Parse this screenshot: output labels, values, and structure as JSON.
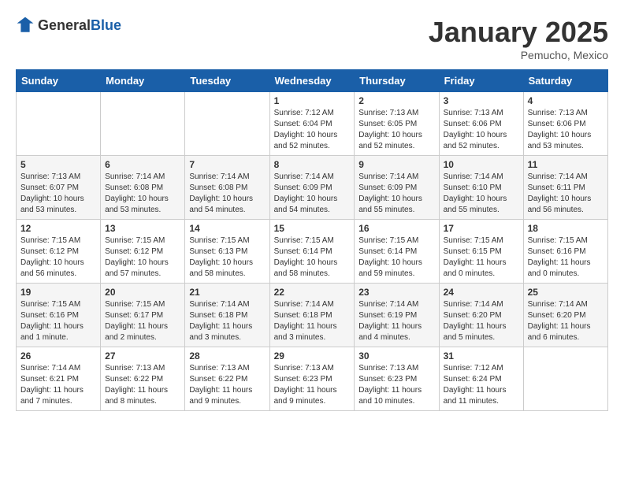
{
  "header": {
    "logo_general": "General",
    "logo_blue": "Blue",
    "title": "January 2025",
    "subtitle": "Pemucho, Mexico"
  },
  "days_of_week": [
    "Sunday",
    "Monday",
    "Tuesday",
    "Wednesday",
    "Thursday",
    "Friday",
    "Saturday"
  ],
  "weeks": [
    [
      {
        "day": "",
        "info": ""
      },
      {
        "day": "",
        "info": ""
      },
      {
        "day": "",
        "info": ""
      },
      {
        "day": "1",
        "info": "Sunrise: 7:12 AM\nSunset: 6:04 PM\nDaylight: 10 hours\nand 52 minutes."
      },
      {
        "day": "2",
        "info": "Sunrise: 7:13 AM\nSunset: 6:05 PM\nDaylight: 10 hours\nand 52 minutes."
      },
      {
        "day": "3",
        "info": "Sunrise: 7:13 AM\nSunset: 6:06 PM\nDaylight: 10 hours\nand 52 minutes."
      },
      {
        "day": "4",
        "info": "Sunrise: 7:13 AM\nSunset: 6:06 PM\nDaylight: 10 hours\nand 53 minutes."
      }
    ],
    [
      {
        "day": "5",
        "info": "Sunrise: 7:13 AM\nSunset: 6:07 PM\nDaylight: 10 hours\nand 53 minutes."
      },
      {
        "day": "6",
        "info": "Sunrise: 7:14 AM\nSunset: 6:08 PM\nDaylight: 10 hours\nand 53 minutes."
      },
      {
        "day": "7",
        "info": "Sunrise: 7:14 AM\nSunset: 6:08 PM\nDaylight: 10 hours\nand 54 minutes."
      },
      {
        "day": "8",
        "info": "Sunrise: 7:14 AM\nSunset: 6:09 PM\nDaylight: 10 hours\nand 54 minutes."
      },
      {
        "day": "9",
        "info": "Sunrise: 7:14 AM\nSunset: 6:09 PM\nDaylight: 10 hours\nand 55 minutes."
      },
      {
        "day": "10",
        "info": "Sunrise: 7:14 AM\nSunset: 6:10 PM\nDaylight: 10 hours\nand 55 minutes."
      },
      {
        "day": "11",
        "info": "Sunrise: 7:14 AM\nSunset: 6:11 PM\nDaylight: 10 hours\nand 56 minutes."
      }
    ],
    [
      {
        "day": "12",
        "info": "Sunrise: 7:15 AM\nSunset: 6:12 PM\nDaylight: 10 hours\nand 56 minutes."
      },
      {
        "day": "13",
        "info": "Sunrise: 7:15 AM\nSunset: 6:12 PM\nDaylight: 10 hours\nand 57 minutes."
      },
      {
        "day": "14",
        "info": "Sunrise: 7:15 AM\nSunset: 6:13 PM\nDaylight: 10 hours\nand 58 minutes."
      },
      {
        "day": "15",
        "info": "Sunrise: 7:15 AM\nSunset: 6:14 PM\nDaylight: 10 hours\nand 58 minutes."
      },
      {
        "day": "16",
        "info": "Sunrise: 7:15 AM\nSunset: 6:14 PM\nDaylight: 10 hours\nand 59 minutes."
      },
      {
        "day": "17",
        "info": "Sunrise: 7:15 AM\nSunset: 6:15 PM\nDaylight: 11 hours\nand 0 minutes."
      },
      {
        "day": "18",
        "info": "Sunrise: 7:15 AM\nSunset: 6:16 PM\nDaylight: 11 hours\nand 0 minutes."
      }
    ],
    [
      {
        "day": "19",
        "info": "Sunrise: 7:15 AM\nSunset: 6:16 PM\nDaylight: 11 hours\nand 1 minute."
      },
      {
        "day": "20",
        "info": "Sunrise: 7:15 AM\nSunset: 6:17 PM\nDaylight: 11 hours\nand 2 minutes."
      },
      {
        "day": "21",
        "info": "Sunrise: 7:14 AM\nSunset: 6:18 PM\nDaylight: 11 hours\nand 3 minutes."
      },
      {
        "day": "22",
        "info": "Sunrise: 7:14 AM\nSunset: 6:18 PM\nDaylight: 11 hours\nand 3 minutes."
      },
      {
        "day": "23",
        "info": "Sunrise: 7:14 AM\nSunset: 6:19 PM\nDaylight: 11 hours\nand 4 minutes."
      },
      {
        "day": "24",
        "info": "Sunrise: 7:14 AM\nSunset: 6:20 PM\nDaylight: 11 hours\nand 5 minutes."
      },
      {
        "day": "25",
        "info": "Sunrise: 7:14 AM\nSunset: 6:20 PM\nDaylight: 11 hours\nand 6 minutes."
      }
    ],
    [
      {
        "day": "26",
        "info": "Sunrise: 7:14 AM\nSunset: 6:21 PM\nDaylight: 11 hours\nand 7 minutes."
      },
      {
        "day": "27",
        "info": "Sunrise: 7:13 AM\nSunset: 6:22 PM\nDaylight: 11 hours\nand 8 minutes."
      },
      {
        "day": "28",
        "info": "Sunrise: 7:13 AM\nSunset: 6:22 PM\nDaylight: 11 hours\nand 9 minutes."
      },
      {
        "day": "29",
        "info": "Sunrise: 7:13 AM\nSunset: 6:23 PM\nDaylight: 11 hours\nand 9 minutes."
      },
      {
        "day": "30",
        "info": "Sunrise: 7:13 AM\nSunset: 6:23 PM\nDaylight: 11 hours\nand 10 minutes."
      },
      {
        "day": "31",
        "info": "Sunrise: 7:12 AM\nSunset: 6:24 PM\nDaylight: 11 hours\nand 11 minutes."
      },
      {
        "day": "",
        "info": ""
      }
    ]
  ]
}
